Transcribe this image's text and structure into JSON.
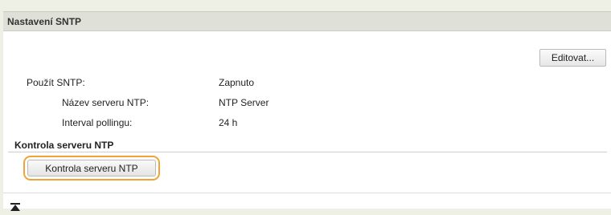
{
  "section": {
    "title": "Nastavení SNTP",
    "edit_label": "Editovat..."
  },
  "settings": [
    {
      "label": "Použít SNTP:",
      "value": "Zapnuto"
    },
    {
      "label": "Název serveru NTP:",
      "value": "NTP Server"
    },
    {
      "label": "Interval pollingu:",
      "value": "24 h"
    }
  ],
  "check": {
    "heading": "Kontrola serveru NTP",
    "button_label": "Kontrola serveru NTP"
  },
  "icons": {
    "back_to_top": "back-to-top-icon"
  },
  "colors": {
    "highlight": "#f2a337",
    "header_bg": "#dfe1d8",
    "page_bg": "#eef0e6"
  }
}
